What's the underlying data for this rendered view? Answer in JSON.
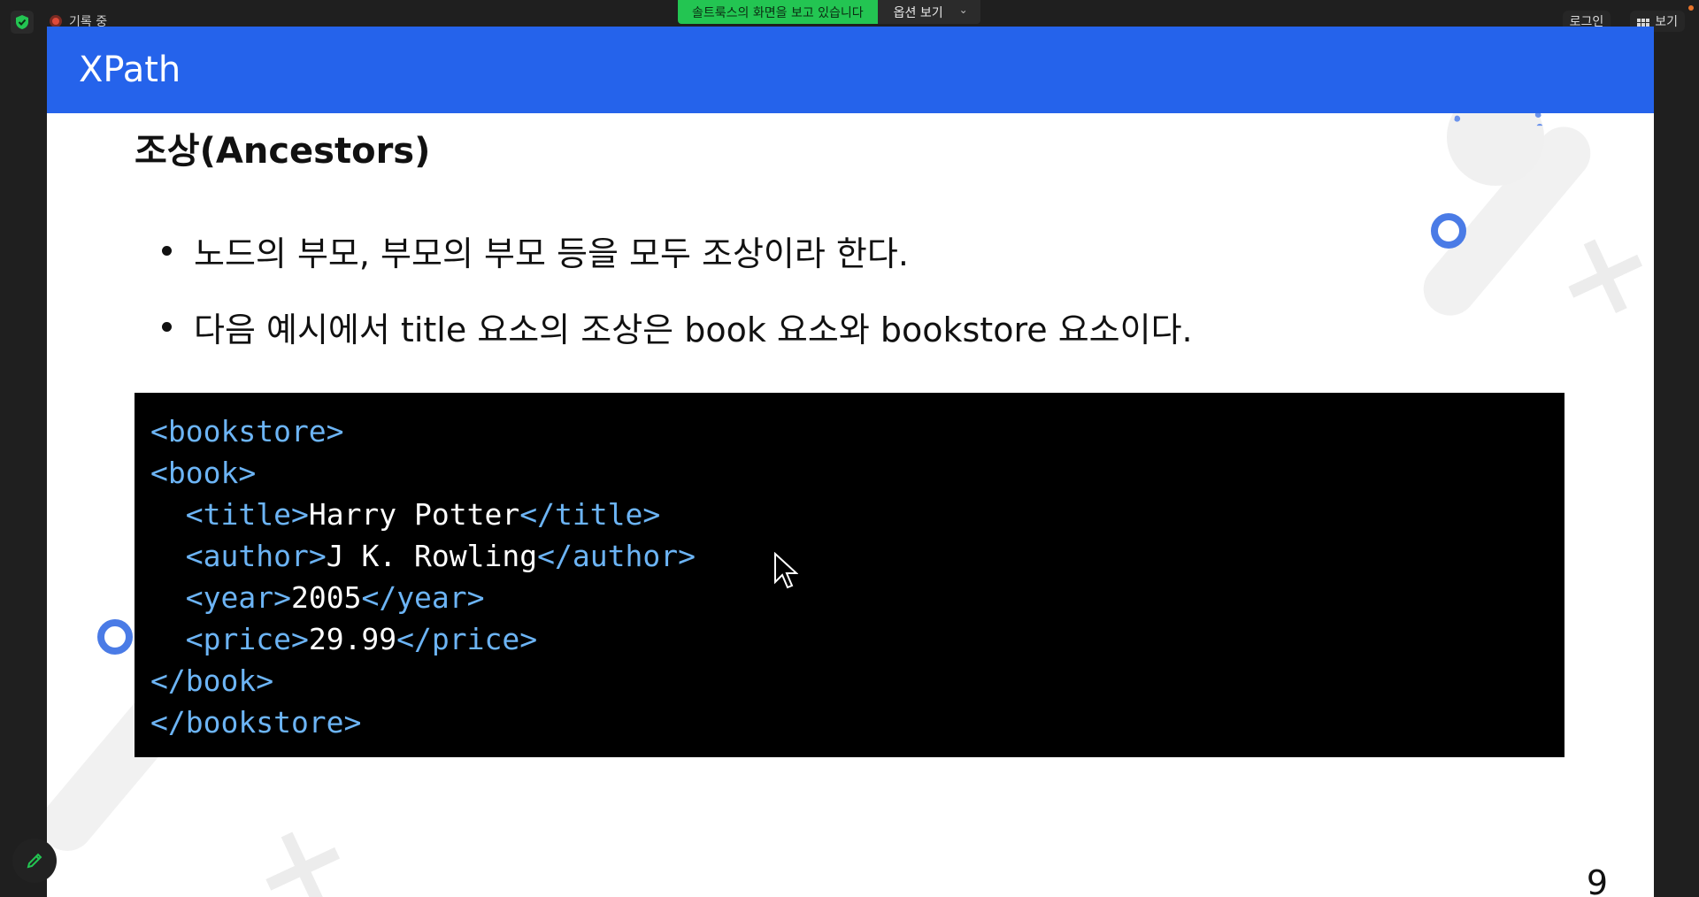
{
  "topbar": {
    "recording_label": "기록 중",
    "share_notice": "솔트룩스의 화면을 보고 있습니다",
    "view_options": "옵션 보기",
    "login_label": "로그인",
    "view_label": "보기"
  },
  "slide": {
    "title": "XPath",
    "heading": "조상(Ancestors)",
    "bullets": [
      "노드의 부모, 부모의 부모 등을 모두 조상이라 한다.",
      "다음 예시에서 title 요소의 조상은 book 요소와 bookstore 요소이다."
    ],
    "code": {
      "l1_tag": "<bookstore>",
      "l2_tag": "<book>",
      "l3_open": "<title>",
      "l3_text": "Harry Potter",
      "l3_close": "</title>",
      "l4_open": "<author>",
      "l4_text": "J K. Rowling",
      "l4_close": "</author>",
      "l5_open": "<year>",
      "l5_text": "2005",
      "l5_close": "</year>",
      "l6_open": "<price>",
      "l6_text": "29.99",
      "l6_close": "</price>",
      "l7_tag": "</book>",
      "l8_tag": "</bookstore>"
    },
    "page_number": "9"
  },
  "colors": {
    "header_blue": "#2563eb",
    "tag_blue": "#6cb4f5",
    "share_green": "#23c552"
  }
}
